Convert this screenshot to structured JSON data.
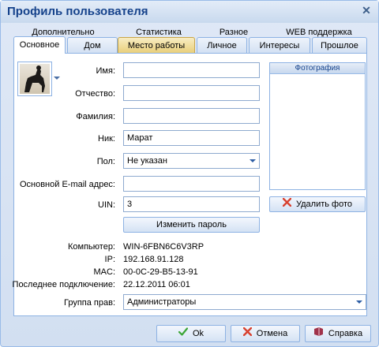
{
  "window": {
    "title": "Профиль пользователя"
  },
  "tabs_row1": [
    "Дополнительно",
    "Статистика",
    "Разное",
    "WEB поддержка"
  ],
  "tabs_row2": [
    "Основное",
    "Дом",
    "Место работы",
    "Личное",
    "Интересы",
    "Прошлое"
  ],
  "active_tab": "Основное",
  "form": {
    "name_label": "Имя:",
    "name_value": "",
    "patronymic_label": "Отчество:",
    "patronymic_value": "",
    "surname_label": "Фамилия:",
    "surname_value": "",
    "nick_label": "Ник:",
    "nick_value": "Марат",
    "gender_label": "Пол:",
    "gender_value": "Не указан",
    "email_label": "Основной E-mail адрес:",
    "email_value": "",
    "uin_label": "UIN:",
    "uin_value": "3",
    "change_password": "Изменить пароль"
  },
  "photo": {
    "header": "Фотография",
    "delete_button": "Удалить фото"
  },
  "info": {
    "computer_label": "Компьютер:",
    "computer_value": "WIN-6FBN6C6V3RP",
    "ip_label": "IP:",
    "ip_value": "192.168.91.128",
    "mac_label": "MAC:",
    "mac_value": "00-0C-29-B5-13-91",
    "last_conn_label": "Последнее подключение:",
    "last_conn_value": "22.12.2011 06:01"
  },
  "rights": {
    "label": "Группа прав:",
    "value": "Администраторы"
  },
  "buttons": {
    "ok": "Ok",
    "cancel": "Отмена",
    "help": "Справка"
  },
  "colors": {
    "title_text": "#15428b",
    "border": "#8db2e3",
    "ok_icon": "#3aa535",
    "cancel_icon": "#d8412f",
    "help_icon": "#a0324a"
  }
}
